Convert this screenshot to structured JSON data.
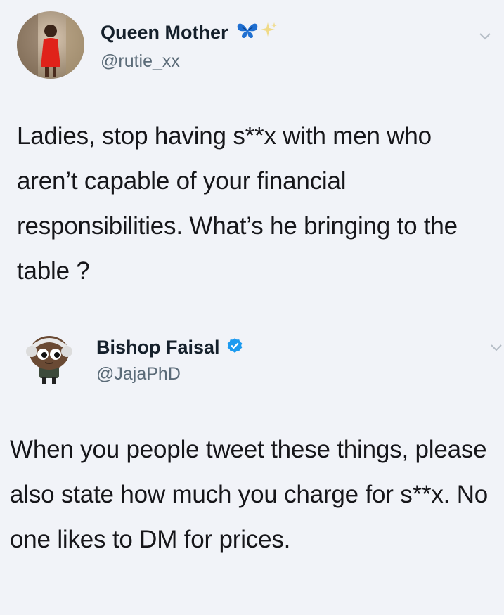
{
  "tweets": [
    {
      "display_name": "Queen Mother",
      "handle": "@rutie_xx",
      "text": "Ladies, stop having s**x with men who aren’t capable of your financial responsibilities. What’s he bringing to the table ?",
      "icons": [
        "butterfly-emoji-icon",
        "sparkle-emoji-icon",
        "chevron-down-icon"
      ]
    },
    {
      "display_name": "Bishop Faisal",
      "handle": "@JajaPhD",
      "text": "When you people tweet these things, please also state how much you charge for s**x. No one likes to DM for prices.",
      "icons": [
        "verified-badge-icon",
        "chevron-down-icon"
      ],
      "verified": true
    }
  ],
  "colors": {
    "background": "#f1f3f8",
    "verified_blue": "#1d9bf0",
    "handle_gray": "#5b6b78"
  }
}
